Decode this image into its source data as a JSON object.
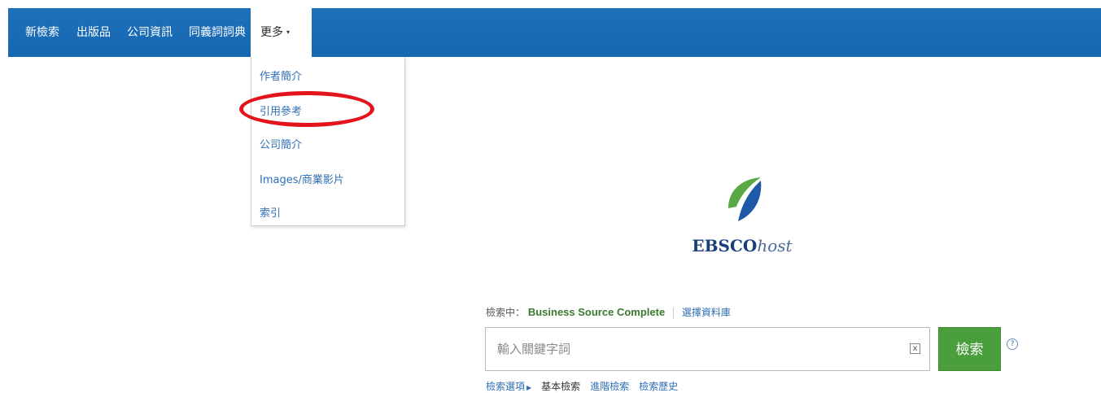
{
  "nav": {
    "items": [
      "新檢索",
      "出版品",
      "公司資訊",
      "同義詞詞典"
    ],
    "more_label": "更多",
    "more_caret": "▾"
  },
  "dropdown": {
    "items": [
      "作者簡介",
      "引用參考",
      "公司簡介",
      "Images/商業影片",
      "索引"
    ]
  },
  "annotation": {
    "color": "#e3141b",
    "highlighted_item": "引用參考"
  },
  "logo": {
    "brand_bold": "EBSCO",
    "brand_italic": "host"
  },
  "search": {
    "searching_label": "檢索中：",
    "database": "Business Source Complete",
    "choose_db_link": "選擇資料庫",
    "placeholder": "輸入關鍵字詞",
    "clear_symbol": "x",
    "button_label": "檢索",
    "help_symbol": "?"
  },
  "search_options": {
    "options_link": "檢索選項",
    "options_arrow": "▶",
    "basic": "基本檢索",
    "advanced": "進階檢索",
    "history": "檢索歷史"
  },
  "colors": {
    "topbar": "#1a6bb4",
    "search_button": "#4a9e3c",
    "link": "#2f6fb5",
    "db_name": "#3a7a2e",
    "logo_green": "#5aa845",
    "logo_blue": "#1e5aa8"
  }
}
